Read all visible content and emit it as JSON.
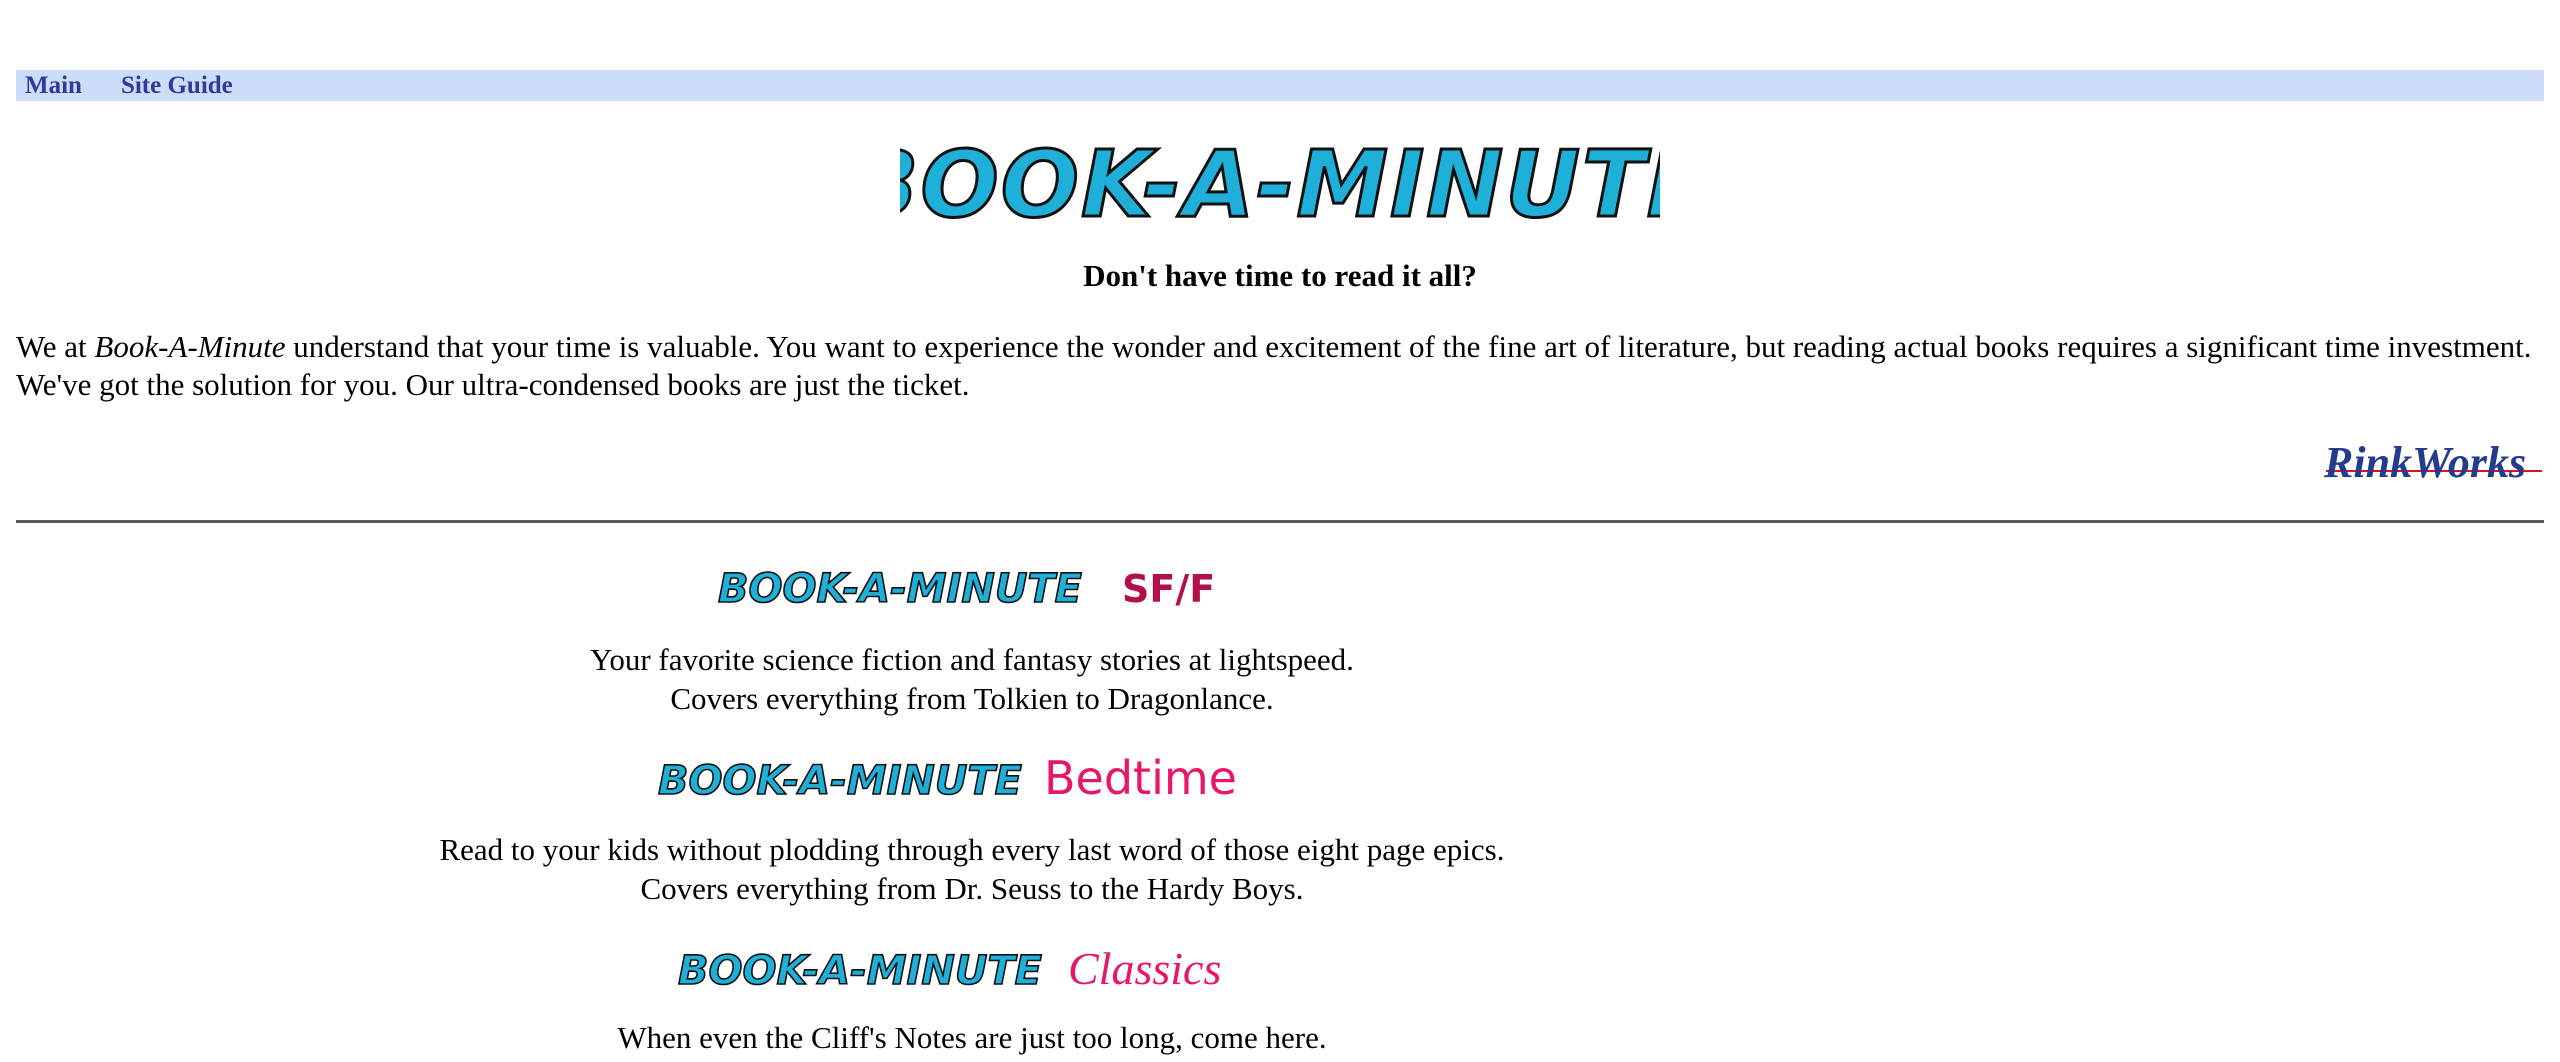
{
  "nav": {
    "items": [
      {
        "label": "Main"
      },
      {
        "label": "Site Guide"
      }
    ]
  },
  "header": {
    "logo_text": "BOOK-A-MINUTE",
    "tagline": "Don't have time to read it all?"
  },
  "intro": {
    "prefix": "We at ",
    "brand": "Book-A-Minute",
    "body": " understand that your time is valuable. You want to experience the wonder and excitement of the fine art of literature, but reading actual books requires a significant time investment. We've got the solution for you. Our ultra-condensed books are just the ticket."
  },
  "footer_logo": {
    "text": "RinkWorks"
  },
  "sections": [
    {
      "logo_base": "BOOK-A-MINUTE",
      "logo_suffix": "SF/F",
      "lines": [
        "Your favorite science fiction and fantasy stories at lightspeed.",
        "Covers everything from Tolkien to Dragonlance."
      ]
    },
    {
      "logo_base": "BOOK-A-MINUTE",
      "logo_suffix": "Bedtime",
      "lines": [
        "Read to your kids without plodding through every last word of those eight page epics.",
        "Covers everything from Dr. Seuss to the Hardy Boys."
      ]
    },
    {
      "logo_base": "BOOK-A-MINUTE",
      "logo_suffix": "Classics",
      "lines": [
        "When even the Cliff's Notes are just too long, come here."
      ]
    }
  ],
  "colors": {
    "nav_bg": "#ccdcf9",
    "nav_link": "#2e3b9a",
    "logo_fill": "#1eb0d8",
    "logo_stroke": "#111111",
    "sff_color": "#b2104a",
    "bedtime_color": "#e8166a",
    "classics_color": "#e8166a",
    "rinkworks_blue": "#233c8c",
    "rinkworks_red": "#e01020"
  }
}
